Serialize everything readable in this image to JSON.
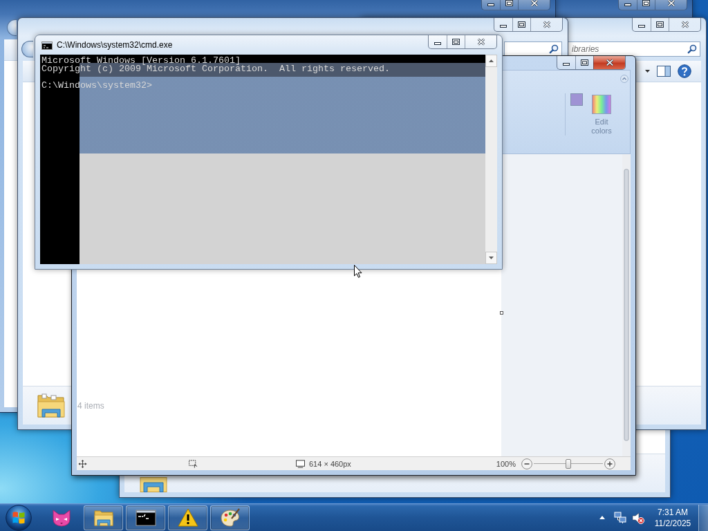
{
  "explorer_windows": [
    {
      "active": false
    },
    {
      "active": false
    },
    {
      "active": false,
      "search": {
        "placeholder": "ibraries"
      }
    },
    {
      "active": false,
      "status": "4 items"
    }
  ],
  "paint_window": {
    "active": true,
    "ribbon": {
      "edit_colors_button": "Edit colors"
    },
    "status_bar": {
      "image_size": "614 × 460px",
      "zoom": "100%",
      "zoom_slider": {
        "level": 0.5
      }
    }
  },
  "cmd_window": {
    "active": false,
    "title": "C:\\Windows\\system32\\cmd.exe",
    "lines": [
      {
        "kind": "output",
        "text": "Microsoft Windows [Version 6.1.7601]"
      },
      {
        "kind": "output",
        "text": "Copyright (c) 2009 Microsoft Corporation.  All rights reserved."
      },
      {
        "kind": "prompt",
        "text": "C:\\Windows\\system32>"
      }
    ]
  },
  "taskbar": {
    "items": [
      {
        "kind": "cat",
        "running": false
      },
      {
        "kind": "explorer",
        "running": true
      },
      {
        "kind": "console",
        "running": true
      },
      {
        "kind": "warning",
        "running": true
      },
      {
        "kind": "paint",
        "running": true
      }
    ],
    "tray": {
      "volume_muted": true
    },
    "clock": {
      "time": "7:31 AM",
      "date": "11/2/2025"
    }
  }
}
